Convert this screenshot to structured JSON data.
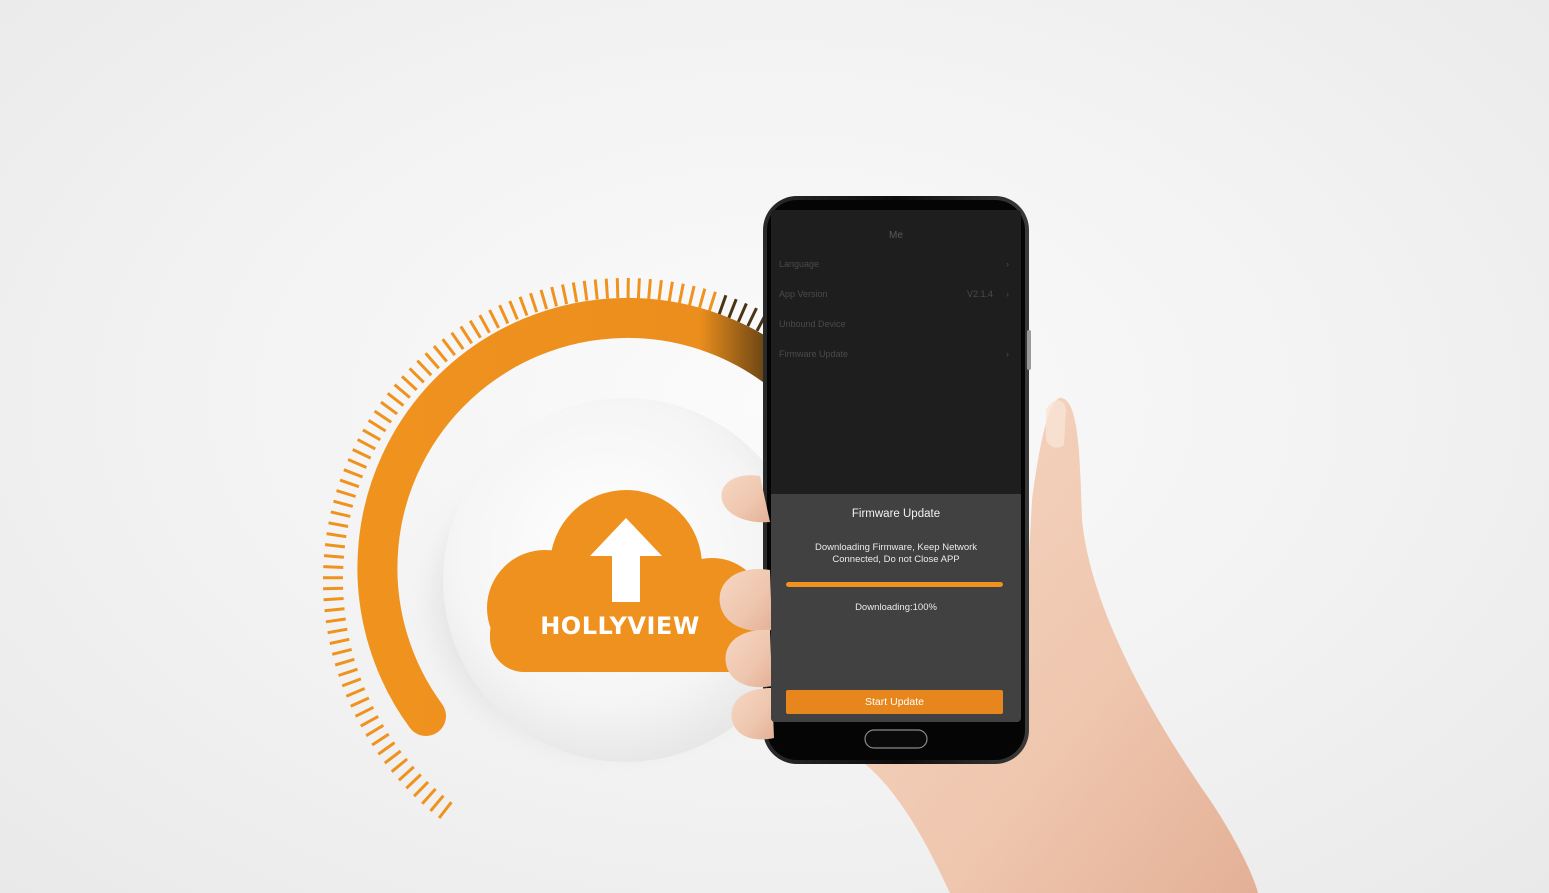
{
  "brand": {
    "name": "HOLLYVIEW"
  },
  "app": {
    "header_title": "Me",
    "menu": [
      {
        "label": "Language",
        "value": "",
        "chevron": "›"
      },
      {
        "label": "App Version",
        "value": "V2.1.4",
        "chevron": "›"
      },
      {
        "label": "Unbound Device",
        "value": "",
        "chevron": ""
      },
      {
        "label": "Firmware Update",
        "value": "",
        "chevron": "›"
      }
    ]
  },
  "dialog": {
    "title": "Firmware Update",
    "message": "Downloading Firmware, Keep Network Connected, Do not Close APP",
    "progress_label": "Downloading:100%",
    "progress_value": 100,
    "button_label": "Start Update"
  },
  "icons": {
    "cloud": "cloud-upload-icon",
    "arrow": "arrow-up-icon",
    "home_button": "home-button"
  },
  "colors": {
    "accent": "#F0921E",
    "screen_bg": "#1E1E1E",
    "dialog_bg": "#414141",
    "background": "#F2F2F2"
  }
}
